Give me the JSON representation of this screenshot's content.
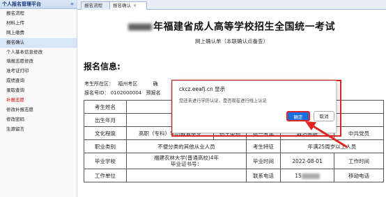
{
  "sidebar": {
    "title": "个人报名管理平台",
    "collapse_icon": "«",
    "items": [
      {
        "label": "报名流程",
        "state": "normal"
      },
      {
        "label": "材料上传",
        "state": "normal"
      },
      {
        "label": "网上缴费",
        "state": "normal"
      },
      {
        "label": "报名确认",
        "state": "active"
      },
      {
        "label": "个人基本信息修改",
        "state": "normal"
      },
      {
        "label": "填报志愿修改",
        "state": "normal"
      },
      {
        "label": "准考证打印",
        "state": "normal"
      },
      {
        "label": "成绩查询",
        "state": "normal"
      },
      {
        "label": "录取查询",
        "state": "normal"
      },
      {
        "label": "补报志愿",
        "state": "warn"
      },
      {
        "label": "修改补报志愿",
        "state": "normal"
      },
      {
        "label": "修改密码",
        "state": "normal"
      },
      {
        "label": "生源留言",
        "state": "normal"
      }
    ]
  },
  "tabs": [
    {
      "label": "报名流程"
    },
    {
      "label": "报名确认",
      "close": "×"
    }
  ],
  "document": {
    "title": "年福建省成人高等学校招生全国统一考试",
    "subtitle": "网上确认单（本联确认点备查）",
    "section_title": "报名信息:",
    "line1_label": "考生所在区：",
    "line1_value": "福州考区",
    "line1_extra": "确",
    "line2_label": "报名号ID：",
    "line2_value": "0102000004",
    "line2_extra": "预报名"
  },
  "table": {
    "rows": [
      [
        "考生姓名",
        "杨",
        "",
        "",
        "",
        "",
        ""
      ],
      [
        "出生年月",
        "1991-0",
        "",
        "",
        "",
        "",
        ""
      ],
      [
        "文化程度",
        "高职（专科）学历教育毕业",
        "招生类别",
        "统一考试",
        "政治面貌",
        "中共党员"
      ],
      [
        "职业类别",
        "不便分类的其他从业人员",
        "考生特征",
        "年满25周岁以上人员"
      ],
      [
        "毕业学校",
        "福建农林大学(普通高校)4年\n毕业证书号：",
        "毕业时间",
        "2022-08-01",
        "工作时间"
      ],
      [
        "工作单位",
        "",
        "联系电话",
        "15",
        "移动电话"
      ]
    ]
  },
  "dialog": {
    "origin": "ckcz.eeafj.cn 显示",
    "message": "您还未进行学历认证，是否现在进行线上认证",
    "ok_label": "确定",
    "cancel_label": "取消"
  },
  "colors": {
    "highlight": "#e02424",
    "primary_button": "#1a6fe0",
    "sidebar_active": "#d9e6f7",
    "warn_text": "#d80000"
  }
}
